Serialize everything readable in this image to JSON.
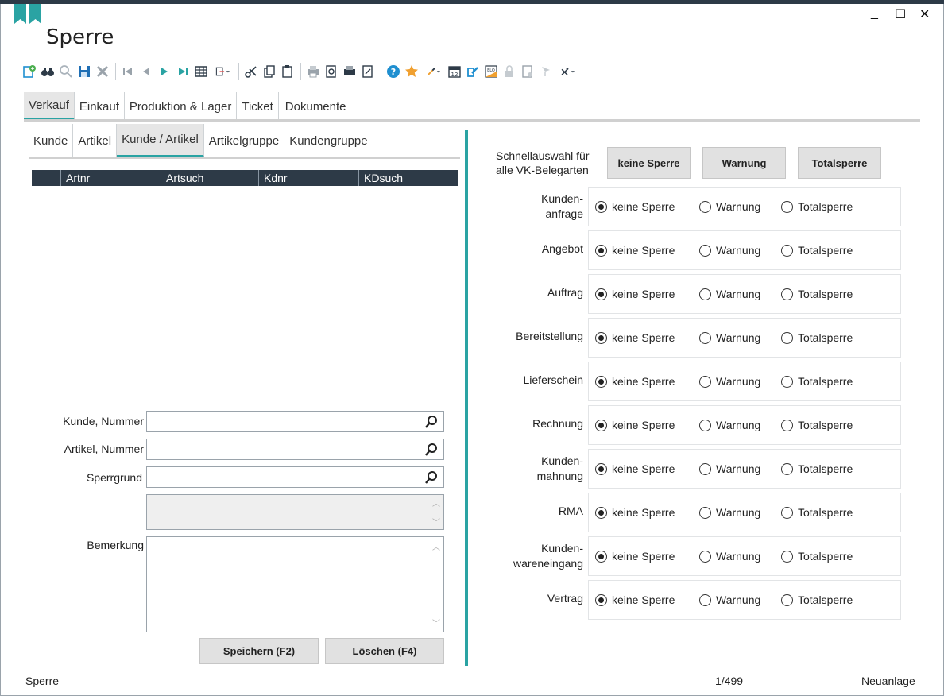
{
  "window": {
    "title": "Sperre",
    "minimize": "_",
    "maximize": "☐",
    "close": "✕"
  },
  "toolbar_icons": [
    "new-icon",
    "binoculars-icon",
    "search-icon",
    "save-icon",
    "delete-icon",
    "first-icon",
    "prev-icon",
    "next-icon",
    "last-icon",
    "table-icon",
    "export-icon",
    "cut-icon",
    "copy-icon",
    "paste-icon",
    "print-icon",
    "print-preview-icon",
    "print-setup-icon",
    "preview-icon",
    "help-icon",
    "favorite-icon",
    "brush-icon",
    "calendar-icon",
    "edit-icon",
    "elo-icon",
    "lock-icon",
    "document-icon",
    "flag-icon",
    "tools-icon"
  ],
  "main_tabs": [
    {
      "label": "Verkauf",
      "active": true
    },
    {
      "label": "Einkauf",
      "active": false
    },
    {
      "label": "Produktion & Lager",
      "active": false
    },
    {
      "label": "Ticket",
      "active": false
    },
    {
      "label": "Dokumente",
      "active": false
    }
  ],
  "sub_tabs": [
    {
      "label": "Kunde",
      "active": false
    },
    {
      "label": "Artikel",
      "active": false
    },
    {
      "label": "Kunde / Artikel",
      "active": true
    },
    {
      "label": "Artikelgruppe",
      "active": false
    },
    {
      "label": "Kundengruppe",
      "active": false
    }
  ],
  "grid": {
    "columns": [
      "Artnr",
      "Artsuch",
      "Kdnr",
      "KDsuch"
    ]
  },
  "form": {
    "kunde_label": "Kunde, Nummer",
    "kunde_value": "",
    "artikel_label": "Artikel, Nummer",
    "artikel_value": "",
    "sperrgrund_label": "Sperrgrund",
    "sperrgrund_value": "",
    "bemerkung_label": "Bemerkung",
    "save_button": "Speichern (F2)",
    "delete_button": "Löschen (F4)"
  },
  "quick": {
    "label_line1": "Schnellauswahl für",
    "label_line2": "alle VK-Belegarten",
    "btn_none": "keine Sperre",
    "btn_warn": "Warnung",
    "btn_total": "Totalsperre"
  },
  "options": {
    "none": "keine Sperre",
    "warn": "Warnung",
    "total": "Totalsperre"
  },
  "rows": [
    {
      "label1": "Kunden-",
      "label2": "anfrage",
      "selected": "none"
    },
    {
      "label1": "Angebot",
      "label2": "",
      "selected": "none"
    },
    {
      "label1": "Auftrag",
      "label2": "",
      "selected": "none"
    },
    {
      "label1": "Bereitstellung",
      "label2": "",
      "selected": "none"
    },
    {
      "label1": "Lieferschein",
      "label2": "",
      "selected": "none"
    },
    {
      "label1": "Rechnung",
      "label2": "",
      "selected": "none"
    },
    {
      "label1": "Kunden-",
      "label2": "mahnung",
      "selected": "none"
    },
    {
      "label1": "RMA",
      "label2": "",
      "selected": "none"
    },
    {
      "label1": "Kunden-",
      "label2": "wareneingang",
      "selected": "none"
    },
    {
      "label1": "Vertrag",
      "label2": "",
      "selected": "none"
    }
  ],
  "status": {
    "left": "Sperre",
    "record": "1/499",
    "mode": "Neuanlage"
  },
  "colors": {
    "accent": "#2aa3a3",
    "header_dark": "#2d3a47",
    "toolbar_blue": "#1f8fd0"
  }
}
